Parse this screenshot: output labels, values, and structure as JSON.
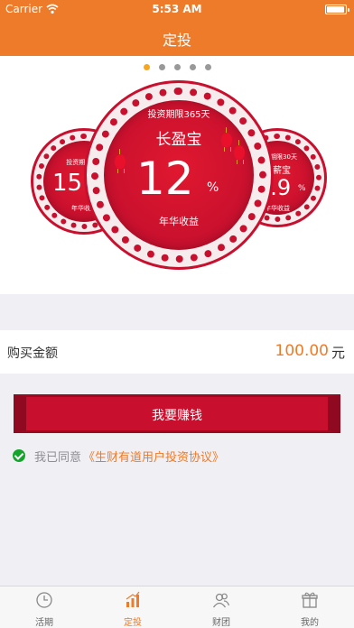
{
  "status_bar": {
    "carrier": "Carrier",
    "time": "5:53 AM"
  },
  "nav": {
    "title": "定投"
  },
  "carousel": {
    "dots": 5,
    "active_dot": 0,
    "center": {
      "term": "投资期限365天",
      "name": "长盈宝",
      "rate": "12",
      "percent": "%",
      "rate_label": "年华收益"
    },
    "left": {
      "term": "投资期限7天",
      "rate": "15",
      "rate_label": "年华收益"
    },
    "right": {
      "term": "投资期限30天",
      "name": "随薪宝",
      "rate": "8.9",
      "percent": "%",
      "rate_label": "年华收益"
    }
  },
  "purchase": {
    "label": "购买金额",
    "amount": "100.00",
    "unit": "元"
  },
  "earn_button": {
    "label": "我要赚钱"
  },
  "agreement": {
    "prefix": "我已同意",
    "link": "《生财有道用户投资协议》"
  },
  "tabbar": {
    "items": [
      {
        "label": "活期",
        "icon": "clock-icon"
      },
      {
        "label": "定投",
        "icon": "bar-chart-icon"
      },
      {
        "label": "财团",
        "icon": "people-icon"
      },
      {
        "label": "我的",
        "icon": "gift-box-icon"
      }
    ],
    "active_index": 1
  },
  "colors": {
    "accent": "#ee7b2a",
    "red": "#c8102e",
    "check_green": "#14a32b"
  }
}
